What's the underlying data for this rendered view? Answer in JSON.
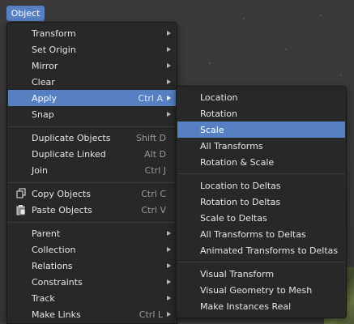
{
  "header": {
    "object_label": "Object"
  },
  "main_menu": {
    "transform": "Transform",
    "set_origin": "Set Origin",
    "mirror": "Mirror",
    "clear": "Clear",
    "apply": "Apply",
    "apply_shortcut": "Ctrl A",
    "snap": "Snap",
    "duplicate_objects": "Duplicate Objects",
    "duplicate_objects_shortcut": "Shift D",
    "duplicate_linked": "Duplicate Linked",
    "duplicate_linked_shortcut": "Alt D",
    "join": "Join",
    "join_shortcut": "Ctrl J",
    "copy_objects": "Copy Objects",
    "copy_objects_shortcut": "Ctrl C",
    "paste_objects": "Paste Objects",
    "paste_objects_shortcut": "Ctrl V",
    "parent": "Parent",
    "collection": "Collection",
    "relations": "Relations",
    "constraints": "Constraints",
    "track": "Track",
    "make_links": "Make Links",
    "make_links_shortcut": "Ctrl L"
  },
  "apply_submenu": {
    "location": "Location",
    "rotation": "Rotation",
    "scale": "Scale",
    "all_transforms": "All Transforms",
    "rotation_scale": "Rotation & Scale",
    "location_to_deltas": "Location to Deltas",
    "rotation_to_deltas": "Rotation to Deltas",
    "scale_to_deltas": "Scale to Deltas",
    "all_transforms_to_deltas": "All Transforms to Deltas",
    "animated_transforms_to_deltas": "Animated Transforms to Deltas",
    "visual_transform": "Visual Transform",
    "visual_geometry_to_mesh": "Visual Geometry to Mesh",
    "make_instances_real": "Make Instances Real"
  },
  "icons": {
    "copy": "copy-icon",
    "paste": "paste-icon",
    "submenu": "chevron-right-icon"
  },
  "colors": {
    "highlight": "#5680c2",
    "menu_bg": "#282828",
    "viewport_bg": "#3d3d3d"
  }
}
